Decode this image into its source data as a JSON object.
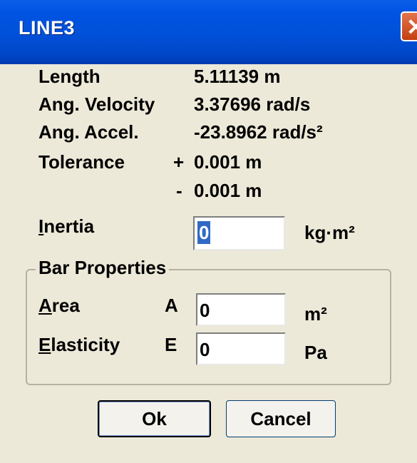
{
  "window": {
    "title": "LINE3",
    "close_glyph": "✕"
  },
  "info": [
    {
      "label": "Length",
      "value": "5.11139 m"
    },
    {
      "label": "Ang. Velocity",
      "value": "3.37696 rad/s"
    },
    {
      "label": "Ang. Accel.",
      "value": "-23.8962 rad/s²"
    }
  ],
  "tolerance": {
    "label": "Tolerance",
    "plus_sign": "+",
    "plus_value": "0.001 m",
    "minus_sign": "-",
    "minus_value": "0.001 m"
  },
  "inertia": {
    "label_mnemonic": "I",
    "label_rest": "nertia",
    "value": "0",
    "unit": "kg·m²"
  },
  "bar_properties": {
    "title": "Bar Properties",
    "area": {
      "label_mnemonic": "A",
      "label_rest": "rea",
      "symbol": "A",
      "value": "0",
      "unit": "m²"
    },
    "elasticity": {
      "label_mnemonic": "E",
      "label_rest": "lasticity",
      "symbol": "E",
      "value": "0",
      "unit": "Pa"
    }
  },
  "buttons": {
    "ok": "Ok",
    "cancel": "Cancel"
  },
  "colors": {
    "titlebar": "#0054E3",
    "dialog_bg": "#ECE9D8",
    "selection": "#316AC5",
    "close": "#C3400F"
  }
}
